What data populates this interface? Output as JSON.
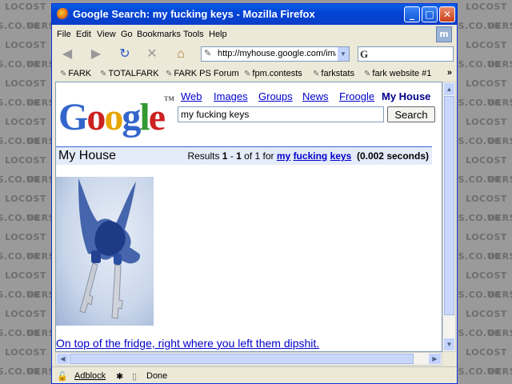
{
  "watermark": {
    "text_a": "LOCOST",
    "text_b": "DERS.CO.UK"
  },
  "window": {
    "title": "Google Search: my fucking keys - Mozilla Firefox",
    "btn_min": "_",
    "btn_max": "□",
    "btn_close": "✕"
  },
  "menu": {
    "file": "File",
    "edit": "Edit",
    "view": "View",
    "go": "Go",
    "bookmarks": "Bookmarks",
    "tools": "Tools",
    "help": "Help"
  },
  "nav": {
    "back_icon": "back-arrow-icon",
    "forward_icon": "forward-arrow-icon",
    "reload_icon": "reload-icon",
    "stop_icon": "stop-icon",
    "home_icon": "home-icon",
    "url": "http://myhouse.google.com/ima",
    "search_engine_glyph": "G"
  },
  "bookmarks": [
    {
      "label": "FARK"
    },
    {
      "label": "TOTALFARK"
    },
    {
      "label": "FARK PS Forum"
    },
    {
      "label": "fpm.contests"
    },
    {
      "label": "farkstats"
    },
    {
      "label": "fark website #1"
    }
  ],
  "bookmarks_more": "»",
  "google": {
    "logo_letters": [
      "G",
      "o",
      "o",
      "g",
      "l",
      "e"
    ],
    "logo_colors": [
      "#3366cc",
      "#cc2222",
      "#e8a500",
      "#3366cc",
      "#339933",
      "#cc2222"
    ],
    "tm": "TM",
    "tabs": [
      {
        "label": "Web",
        "current": false
      },
      {
        "label": "Images",
        "current": false
      },
      {
        "label": "Groups",
        "current": false
      },
      {
        "label": "News",
        "current": false
      },
      {
        "label": "Froogle",
        "current": false
      },
      {
        "label": "My House",
        "current": true
      }
    ],
    "query": "my fucking keys",
    "search_button": "Search",
    "section": "My House",
    "results_prefix": "Results ",
    "results_from": "1",
    "results_dash": " - ",
    "results_to": "1",
    "results_of": " of 1 for ",
    "term_1": "my",
    "term_2": "fucking",
    "term_3": "keys",
    "results_time": "(0.002 seconds)",
    "result_link": "On top of the fridge, right where you left them dipshit."
  },
  "status": {
    "adblock": "Adblock",
    "done": "Done"
  }
}
